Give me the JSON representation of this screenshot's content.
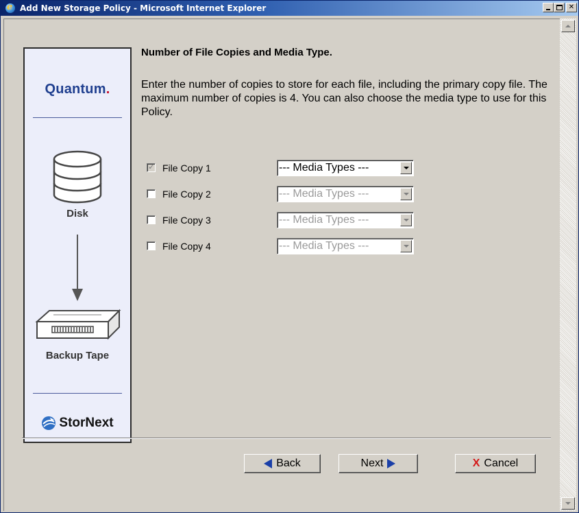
{
  "window": {
    "title": "Add New Storage Policy - Microsoft Internet Explorer",
    "title_icon": "ie-icon",
    "controls": [
      "minimize-icon",
      "maximize-icon",
      "close-icon"
    ]
  },
  "brand_panel": {
    "logo": "Quantum",
    "logo_dot": ".",
    "disk_label": "Disk",
    "tape_label": "Backup Tape",
    "product": "StorNext",
    "icons": [
      "disk-icon",
      "arrow-down-icon",
      "tape-icon",
      "stornext-logo-icon"
    ]
  },
  "content": {
    "heading": "Number of File Copies and Media Type.",
    "description": "Enter the number of copies to store for each file, including the primary copy file. The maximum number of copies is 4. You can also choose the media type to use for this Policy.",
    "copies": [
      {
        "label": "File Copy 1",
        "checked": true,
        "enabled": false,
        "media": "--- Media Types ---",
        "media_enabled": true
      },
      {
        "label": "File Copy 2",
        "checked": false,
        "enabled": true,
        "media": "--- Media Types ---",
        "media_enabled": false
      },
      {
        "label": "File Copy 3",
        "checked": false,
        "enabled": true,
        "media": "--- Media Types ---",
        "media_enabled": false
      },
      {
        "label": "File Copy 4",
        "checked": false,
        "enabled": true,
        "media": "--- Media Types ---",
        "media_enabled": false
      }
    ]
  },
  "buttons": {
    "back": "Back",
    "next": "Next",
    "cancel": "Cancel",
    "cancel_glyph": "X"
  },
  "colors": {
    "title_gradient_start": "#0a246a",
    "title_gradient_end": "#a6caf0",
    "face": "#d4d0c8",
    "panel": "#eceefa",
    "brand_blue": "#1f3f8f",
    "brand_red": "#c8102e",
    "arrow_blue": "#1a3fa8",
    "cancel_red": "#d41818"
  }
}
